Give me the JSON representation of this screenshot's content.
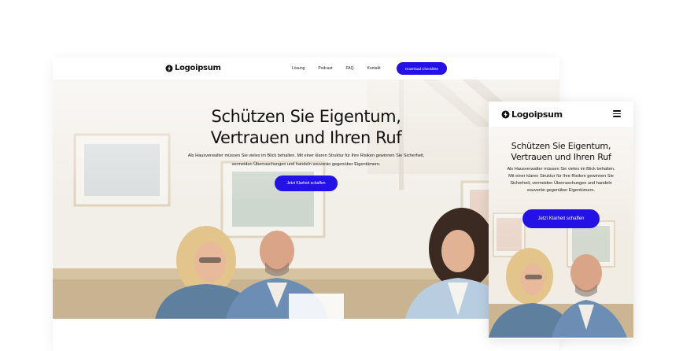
{
  "desktop": {
    "nav": {
      "logo_text": "Logoipsum",
      "links": [
        "Lösung",
        "Podcast",
        "FAQ",
        "Kontakt"
      ],
      "cta_label": "Download Checkliste"
    },
    "hero": {
      "title_line1": "Schützen Sie Eigentum,",
      "title_line2": "Vertrauen und Ihren Ruf",
      "subtitle": "Als Hausverwalter müssen Sie vieles im Blick behalten. Mit einer klaren Struktur für Ihre Risiken gewinnen Sie Sicherheit, vermeiden Überraschungen und handeln souverän gegenüber Eigentümern.",
      "cta_label": "Jetzt Klarheit schaffen"
    }
  },
  "mobile": {
    "nav": {
      "logo_text": "Logoipsum",
      "menu_icon": "hamburger-icon"
    },
    "hero": {
      "title_line1": "Schützen Sie Eigentum,",
      "title_line2": "Vertrauen und Ihren Ruf",
      "subtitle": "Als Hausverwalter müssen Sie vieles im Blick behalten. Mit einer klaren Struktur für Ihre Risiken gewinnen Sie Sicherheit, vermeiden Überraschungen und handeln souverän gegenüber Eigentümern.",
      "cta_label": "Jetzt Klarheit schaffen"
    }
  },
  "colors": {
    "accent": "#2311e6",
    "text": "#111111",
    "background": "#ffffff"
  }
}
